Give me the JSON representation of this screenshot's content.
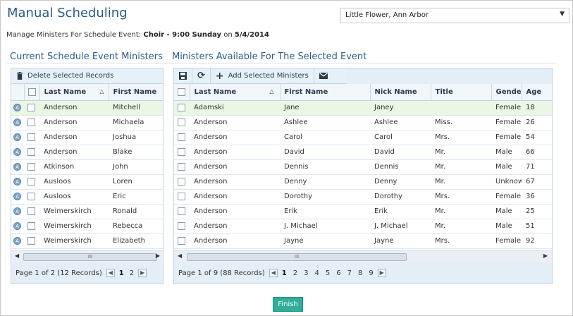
{
  "page": {
    "title": "Manual Scheduling",
    "parish_select": "Little Flower, Ann Arbor",
    "subhead_prefix": "Manage Ministers For Schedule Event:",
    "event_name": "Choir - 9:00 Sunday",
    "on_word": "on",
    "event_date": "5/4/2014",
    "finish_label": "Finish"
  },
  "left": {
    "section_title": "Current Schedule Event Ministers",
    "toolbar": {
      "delete_label": "Delete Selected Records"
    },
    "columns": [
      "Last Name",
      "First Name"
    ],
    "rows": [
      {
        "last": "Anderson",
        "first": "Mitchell"
      },
      {
        "last": "Anderson",
        "first": "Michaela"
      },
      {
        "last": "Anderson",
        "first": "Joshua"
      },
      {
        "last": "Anderson",
        "first": "Blake"
      },
      {
        "last": "Atkinson",
        "first": "John"
      },
      {
        "last": "Ausloos",
        "first": "Loren"
      },
      {
        "last": "Ausloos",
        "first": "Eric"
      },
      {
        "last": "Weimerskirch",
        "first": "Ronald"
      },
      {
        "last": "Weimerskirch",
        "first": "Rebecca"
      },
      {
        "last": "Weimerskirch",
        "first": "Elizabeth"
      }
    ],
    "pager": {
      "info": "Page 1 of 2 (12 Records)",
      "pages": [
        "1",
        "2"
      ],
      "current": "1"
    }
  },
  "right": {
    "section_title": "Ministers Available For The Selected Event",
    "toolbar": {
      "add_label": "Add Selected Ministers"
    },
    "columns": [
      "Last Name",
      "First Name",
      "Nick Name",
      "Title",
      "Gender",
      "Age"
    ],
    "rows": [
      {
        "last": "Adamski",
        "first": "Jane",
        "nick": "Janey",
        "title": "",
        "gender": "Female",
        "age": "18"
      },
      {
        "last": "Anderson",
        "first": "Ashlee",
        "nick": "Ashlee",
        "title": "Miss.",
        "gender": "Female",
        "age": "26"
      },
      {
        "last": "Anderson",
        "first": "Carol",
        "nick": "Carol",
        "title": "Mrs.",
        "gender": "Female",
        "age": "54"
      },
      {
        "last": "Anderson",
        "first": "David",
        "nick": "David",
        "title": "Mr.",
        "gender": "Male",
        "age": "66"
      },
      {
        "last": "Anderson",
        "first": "Dennis",
        "nick": "Dennis",
        "title": "Mr.",
        "gender": "Male",
        "age": "71"
      },
      {
        "last": "Anderson",
        "first": "Denny",
        "nick": "Denny",
        "title": "Mr.",
        "gender": "Unknow",
        "age": "67"
      },
      {
        "last": "Anderson",
        "first": "Dorothy",
        "nick": "Dorothy",
        "title": "Mrs.",
        "gender": "Female",
        "age": "36"
      },
      {
        "last": "Anderson",
        "first": "Erik",
        "nick": "Erik",
        "title": "Mr.",
        "gender": "Male",
        "age": "25"
      },
      {
        "last": "Anderson",
        "first": "J. Michael",
        "nick": "J. Michael",
        "title": "Mr.",
        "gender": "Male",
        "age": "51"
      },
      {
        "last": "Anderson",
        "first": "Jayne",
        "nick": "Jayne",
        "title": "Mrs.",
        "gender": "Female",
        "age": "92"
      }
    ],
    "pager": {
      "info": "Page 1 of 9 (88 Records)",
      "pages": [
        "1",
        "2",
        "3",
        "4",
        "5",
        "6",
        "7",
        "8",
        "9"
      ],
      "current": "1"
    }
  },
  "colors": {
    "accent": "#2a5d8a",
    "finish": "#2fae9a",
    "highlight_row": "#e9f7e4"
  }
}
